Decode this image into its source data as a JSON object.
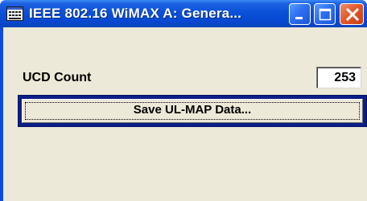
{
  "window": {
    "title": "IEEE 802.16 WiMAX A: Genera...",
    "controls": {
      "minimize_icon": "minimize-icon",
      "maximize_icon": "maximize-icon",
      "close_icon": "close-icon"
    },
    "app_icon": "window-app-icon"
  },
  "form": {
    "ucd_count": {
      "label": "UCD Count",
      "value": "253"
    },
    "save_ul_map": {
      "label": "Save UL-MAP Data..."
    }
  },
  "colors": {
    "titlebar": "#0a50d8",
    "client_bg": "#ece9d8",
    "close_button": "#e15a2e",
    "focus_frame": "#0a1e86"
  }
}
